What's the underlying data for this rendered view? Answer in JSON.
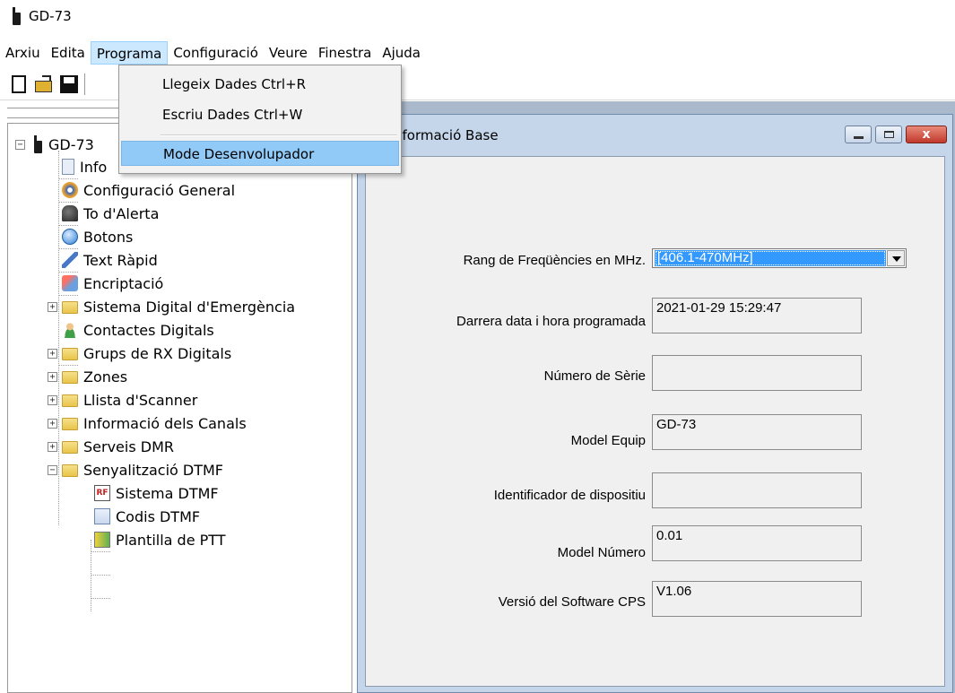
{
  "window": {
    "title": "GD-73"
  },
  "menu": {
    "items": [
      "Arxiu",
      "Edita",
      "Programa",
      "Configuració",
      "Veure",
      "Finestra",
      "Ajuda"
    ],
    "active": "Programa"
  },
  "dropdown": {
    "read": "Llegeix Dades Ctrl+R",
    "write": "Escriu Dades  Ctrl+W",
    "dev_mode": "Mode Desenvolupador"
  },
  "toolbar": {
    "icons": [
      "new-file-icon",
      "open-folder-icon",
      "save-icon"
    ]
  },
  "tree": {
    "root": "GD-73",
    "items": [
      {
        "label": "Informació Base",
        "icon": "document-icon"
      },
      {
        "label": "Configuració General",
        "icon": "gear-icon"
      },
      {
        "label": "To d'Alerta",
        "icon": "bell-icon"
      },
      {
        "label": "Botons",
        "icon": "button-icon"
      },
      {
        "label": "Text Ràpid",
        "icon": "pen-icon"
      },
      {
        "label": "Encriptació",
        "icon": "lock-icon"
      },
      {
        "label": "Sistema Digital d'Emergència",
        "icon": "folder-icon"
      },
      {
        "label": "Contactes Digitals",
        "icon": "contact-icon"
      },
      {
        "label": "Grups de RX Digitals",
        "icon": "folder-icon"
      },
      {
        "label": "Zones",
        "icon": "folder-icon"
      },
      {
        "label": "Llista d'Scanner",
        "icon": "folder-icon"
      },
      {
        "label": "Informació dels Canals",
        "icon": "folder-icon"
      },
      {
        "label": "Serveis DMR",
        "icon": "folder-icon"
      },
      {
        "label": "Senyalització DTMF",
        "icon": "folder-icon"
      },
      {
        "label": "Sistema DTMF",
        "icon": "dtmf-system-icon"
      },
      {
        "label": "Codis DTMF",
        "icon": "codes-icon"
      },
      {
        "label": "Plantilla de PTT",
        "icon": "ptt-icon"
      }
    ],
    "root_visible_label": "GD-73",
    "first_item_visible": "Info"
  },
  "child_window": {
    "title": "nformació Base",
    "close_glyph": "x"
  },
  "form": {
    "freq_label": "Rang de Freqüències en MHz.",
    "freq_value": "[406.1-470MHz]",
    "last_prog_label": "Darrera data i hora programada",
    "last_prog_value": "2021-01-29 15:29:47",
    "serial_label": "Número de Sèrie",
    "serial_value": "",
    "model_label": "Model Equip",
    "model_value": "GD-73",
    "device_id_label": "Identificador de dispositiu",
    "device_id_value": "",
    "model_number_label": "Model Número",
    "model_number_value": "0.01",
    "cps_label": "Versió del Software CPS",
    "cps_value": "V1.06"
  }
}
